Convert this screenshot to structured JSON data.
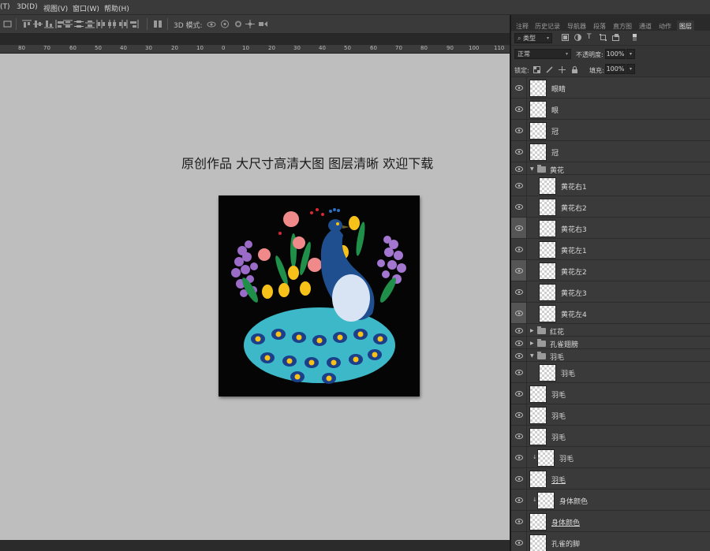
{
  "menu": [
    "(T)",
    "3D(D)",
    "视图(V)",
    "窗口(W)",
    "帮助(H)"
  ],
  "options_bar": {
    "mode_3d_label": "3D 模式:"
  },
  "ruler": [
    "80",
    "70",
    "60",
    "50",
    "40",
    "30",
    "20",
    "10",
    "0",
    "10",
    "20",
    "30",
    "40",
    "50",
    "60",
    "70",
    "80",
    "90",
    "100",
    "110"
  ],
  "canvas": {
    "headline": "原创作品 大尺寸高清大图 图层清晰 欢迎下载"
  },
  "panel": {
    "tabs": [
      "注释",
      "历史记录",
      "导航器",
      "段落",
      "直方图",
      "通道",
      "动作",
      "图层"
    ],
    "active_tab": "图层",
    "filter_kind": "类型",
    "blend_mode": "正常",
    "opacity_label": "不透明度:",
    "opacity_value": "100%",
    "lock_label": "锁定:",
    "fill_label": "填充:",
    "fill_value": "100%"
  },
  "layers": [
    {
      "name": "眼睛",
      "type": "layer",
      "indent": 0
    },
    {
      "name": "眼",
      "type": "layer",
      "indent": 0
    },
    {
      "name": "冠",
      "type": "layer",
      "indent": 0
    },
    {
      "name": "冠",
      "type": "layer",
      "indent": 0
    },
    {
      "name": "黄花",
      "type": "group",
      "open": true
    },
    {
      "name": "黄花右1",
      "type": "layer",
      "indent": 1
    },
    {
      "name": "黄花右2",
      "type": "layer",
      "indent": 1
    },
    {
      "name": "黄花右3",
      "type": "layer",
      "indent": 1,
      "eye_gray": true
    },
    {
      "name": "黄花左1",
      "type": "layer",
      "indent": 1
    },
    {
      "name": "黄花左2",
      "type": "layer",
      "indent": 1,
      "eye_gray": true
    },
    {
      "name": "黄花左3",
      "type": "layer",
      "indent": 1
    },
    {
      "name": "黄花左4",
      "type": "layer",
      "indent": 1,
      "eye_gray": true
    },
    {
      "name": "红花",
      "type": "group",
      "open": false
    },
    {
      "name": "孔雀翅膀",
      "type": "group",
      "open": false
    },
    {
      "name": "羽毛",
      "type": "group",
      "open": true
    },
    {
      "name": "羽毛",
      "type": "layer",
      "indent": 1
    },
    {
      "name": "羽毛",
      "type": "layer",
      "indent": 0
    },
    {
      "name": "羽毛",
      "type": "layer",
      "indent": 0
    },
    {
      "name": "羽毛",
      "type": "layer",
      "indent": 0
    },
    {
      "name": "羽毛",
      "type": "layer",
      "indent": 0,
      "clipped": true
    },
    {
      "name": "羽毛",
      "type": "layer",
      "indent": 0,
      "underline": true
    },
    {
      "name": "身体颜色",
      "type": "layer",
      "indent": 0,
      "clipped": true
    },
    {
      "name": "身体颜色",
      "type": "layer",
      "indent": 0,
      "underline": true
    },
    {
      "name": "孔雀的脚",
      "type": "layer",
      "indent": 0
    }
  ],
  "colors": {
    "canvas_bg": "#bebebe",
    "panel_bg": "#353535",
    "artwork_bg": "#050505",
    "peacock_body": "#1f4f8f",
    "feather_teal": "#3db8c8",
    "flower_yellow": "#f6c21a",
    "flower_pink": "#f08a8a",
    "lilac": "#9b6bc8"
  }
}
